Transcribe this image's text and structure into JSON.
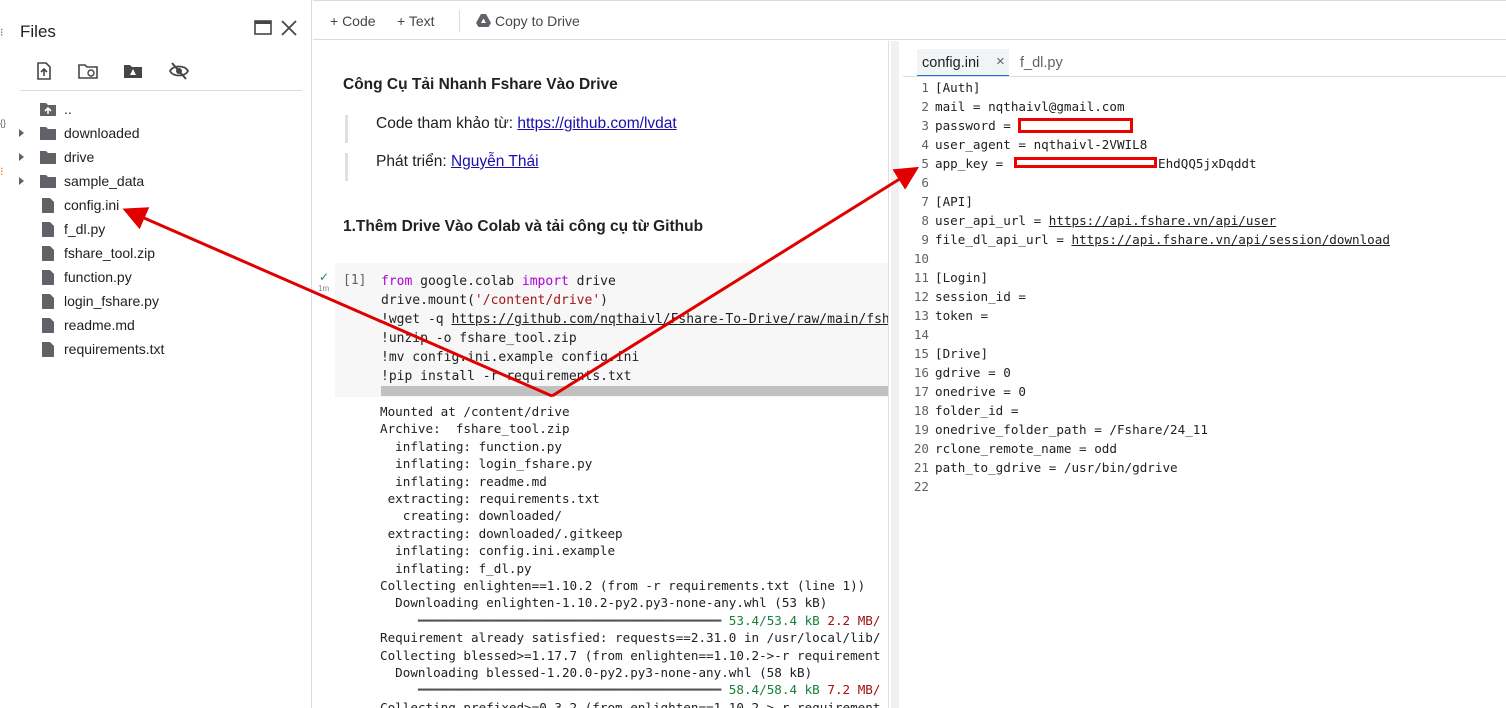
{
  "left_strip": {
    "glyphs": [
      "⁝",
      "{}",
      "⁝"
    ]
  },
  "files_panel": {
    "title": "Files",
    "tree": [
      {
        "name": "..",
        "kind": "up"
      },
      {
        "name": "downloaded",
        "kind": "folder"
      },
      {
        "name": "drive",
        "kind": "folder"
      },
      {
        "name": "sample_data",
        "kind": "folder"
      },
      {
        "name": "config.ini",
        "kind": "file"
      },
      {
        "name": "f_dl.py",
        "kind": "file"
      },
      {
        "name": "fshare_tool.zip",
        "kind": "file"
      },
      {
        "name": "function.py",
        "kind": "file"
      },
      {
        "name": "login_fshare.py",
        "kind": "file"
      },
      {
        "name": "readme.md",
        "kind": "file"
      },
      {
        "name": "requirements.txt",
        "kind": "file"
      }
    ]
  },
  "topbar": {
    "code_label": "+ Code",
    "text_label": "+ Text",
    "copy_drive_label": "Copy to Drive"
  },
  "notebook": {
    "title": "Công Cụ Tải Nhanh Fshare Vào Drive",
    "ref_label": "Code tham khảo từ: ",
    "ref_link": "https://github.com/lvdat",
    "dev_label": "Phát triển: ",
    "dev_link": "Nguyễn Thái",
    "section_heading": "1.Thêm Drive Vào Colab và tải công cụ từ Github",
    "exec_count": "[1]",
    "run_time": "1m",
    "code": {
      "l1_kw1": "from",
      "l1_mid": " google.colab ",
      "l1_kw2": "import",
      "l1_end": " drive",
      "l2_start": "drive.mount(",
      "l2_str": "'/content/drive'",
      "l2_end": ")",
      "l3_start": "!wget -q ",
      "l3_url": "https://github.com/nqthaivl/Fshare-To-Drive/raw/main/fsha",
      "l4": "!unzip -o fshare_tool.zip",
      "l5": "!mv config.ini.example config.ini",
      "l6": "!pip install -r requirements.txt"
    },
    "output": [
      "Mounted at /content/drive",
      "Archive:  fshare_tool.zip",
      "  inflating: function.py",
      "  inflating: login_fshare.py",
      "  inflating: readme.md",
      " extracting: requirements.txt",
      "   creating: downloaded/",
      " extracting: downloaded/.gitkeep",
      "  inflating: config.ini.example",
      "  inflating: f_dl.py",
      "Collecting enlighten==1.10.2 (from -r requirements.txt (line 1))",
      "  Downloading enlighten-1.10.2-py2.py3-none-any.whl (53 kB)"
    ],
    "progress1": {
      "bar": "     ━━━━━━━━━━━━━━━━━━━━━━━━━━━━━━━━━━━━━━━━ ",
      "size": "53.4/53.4 kB",
      "speed": " 2.2 MB/"
    },
    "output2": [
      "Requirement already satisfied: requests==2.31.0 in /usr/local/lib/",
      "Collecting blessed>=1.17.7 (from enlighten==1.10.2->-r requirement",
      "  Downloading blessed-1.20.0-py2.py3-none-any.whl (58 kB)"
    ],
    "progress2": {
      "bar": "     ━━━━━━━━━━━━━━━━━━━━━━━━━━━━━━━━━━━━━━━━ ",
      "size": "58.4/58.4 kB",
      "speed": " 7.2 MB/"
    },
    "output3": "Collecting prefixed>=0.3.2 (from enlighten==1.10.2->-r requirement"
  },
  "editor": {
    "tabs": [
      {
        "label": "config.ini",
        "active": true,
        "close": "×"
      },
      {
        "label": "f_dl.py",
        "active": false
      }
    ],
    "lines": [
      {
        "n": "1",
        "t": "[Auth]"
      },
      {
        "n": "2",
        "t": "mail = nqthaivl@gmail.com"
      },
      {
        "n": "3",
        "t": "password = "
      },
      {
        "n": "4",
        "t": "user_agent = nqthaivl-2VWIL8"
      },
      {
        "n": "5",
        "t": "app_key = ",
        "tail": "EhdQQ5jxDqddt"
      },
      {
        "n": "6",
        "t": ""
      },
      {
        "n": "7",
        "t": "[API]"
      },
      {
        "n": "8",
        "t": "user_api_url = ",
        "link": "https://api.fshare.vn/api/user"
      },
      {
        "n": "9",
        "t": "file_dl_api_url = ",
        "link": "https://api.fshare.vn/api/session/download"
      },
      {
        "n": "10",
        "t": ""
      },
      {
        "n": "11",
        "t": "[Login]"
      },
      {
        "n": "12",
        "t": "session_id ="
      },
      {
        "n": "13",
        "t": "token ="
      },
      {
        "n": "14",
        "t": ""
      },
      {
        "n": "15",
        "t": "[Drive]"
      },
      {
        "n": "16",
        "t": "gdrive = 0"
      },
      {
        "n": "17",
        "t": "onedrive = 0"
      },
      {
        "n": "18",
        "t": "folder_id ="
      },
      {
        "n": "19",
        "t": "onedrive_folder_path = /Fshare/24_11"
      },
      {
        "n": "20",
        "t": "rclone_remote_name = odd"
      },
      {
        "n": "21",
        "t": "path_to_gdrive = /usr/bin/gdrive"
      },
      {
        "n": "22",
        "t": ""
      }
    ]
  },
  "colors": {
    "accent": "#1a73e8",
    "annotation": "#e00000",
    "link": "#1a0dab",
    "keyword": "#af00db",
    "string": "#a31515"
  }
}
